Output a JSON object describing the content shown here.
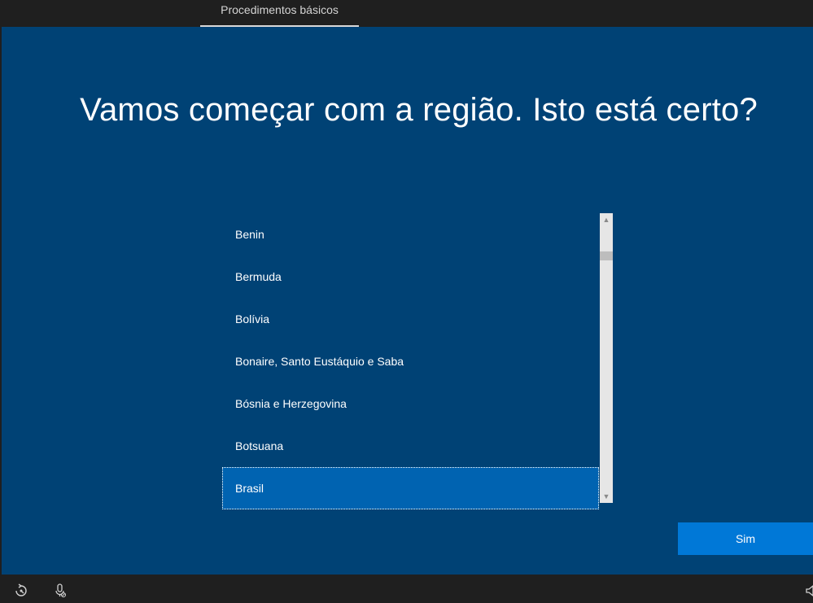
{
  "header": {
    "tab_label": "Procedimentos básicos"
  },
  "main": {
    "heading": "Vamos começar com a região. Isto está certo?"
  },
  "region_list": {
    "items": [
      {
        "label": "Benin"
      },
      {
        "label": "Bermuda"
      },
      {
        "label": "Bolívia"
      },
      {
        "label": "Bonaire, Santo Eustáquio e Saba"
      },
      {
        "label": "Bósnia e Herzegovina"
      },
      {
        "label": "Botsuana"
      },
      {
        "label": "Brasil"
      }
    ],
    "selected": "Brasil"
  },
  "actions": {
    "confirm_label": "Sim"
  },
  "footer": {
    "icons": [
      "ease-of-access-icon",
      "microphone-icon",
      "volume-icon"
    ]
  },
  "colors": {
    "background": "#004275",
    "selected_item": "#0063b1",
    "primary_button": "#0078d7",
    "chrome": "#1f1f1f"
  }
}
